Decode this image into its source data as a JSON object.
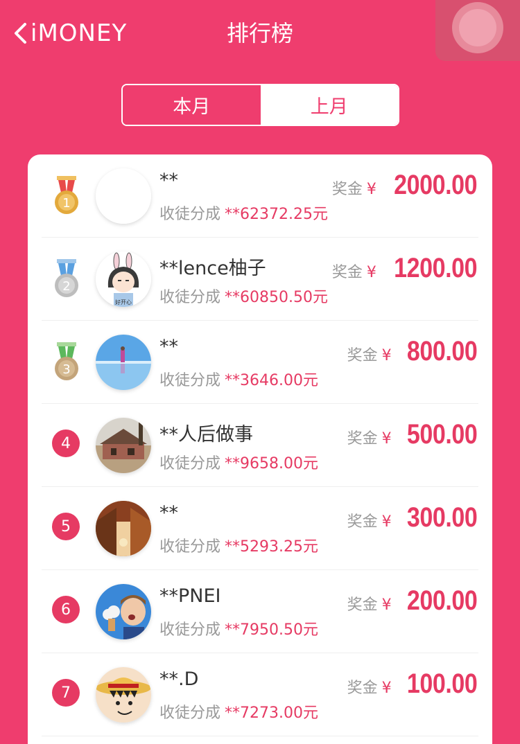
{
  "header": {
    "back_label": "iMONEY",
    "title": "排行榜"
  },
  "tabs": [
    {
      "label": "本月",
      "active": true
    },
    {
      "label": "上月",
      "active": false
    }
  ],
  "list": {
    "commission_label": "收徒分成",
    "bonus_label": "奖金",
    "currency": "¥",
    "rows": [
      {
        "rank": "1",
        "name": "**",
        "commission": "**62372.25元",
        "bonus": "2000.00",
        "medal": "gold",
        "avatar": "blank"
      },
      {
        "rank": "2",
        "name": "**lence柚子",
        "commission": "**60850.50元",
        "bonus": "1200.00",
        "medal": "silver",
        "avatar": "bunny-girl"
      },
      {
        "rank": "3",
        "name": "**",
        "commission": "**3646.00元",
        "bonus": "800.00",
        "medal": "bronze",
        "avatar": "salt-flat"
      },
      {
        "rank": "4",
        "name": "**人后做事",
        "commission": "**9658.00元",
        "bonus": "500.00",
        "medal": "none",
        "avatar": "house"
      },
      {
        "rank": "5",
        "name": "**",
        "commission": "**5293.25元",
        "bonus": "300.00",
        "medal": "none",
        "avatar": "town"
      },
      {
        "rank": "6",
        "name": "**PNEI",
        "commission": "**7950.50元",
        "bonus": "200.00",
        "medal": "none",
        "avatar": "boy-icecream"
      },
      {
        "rank": "7",
        "name": "**.D",
        "commission": "**7273.00元",
        "bonus": "100.00",
        "medal": "none",
        "avatar": "straw-hat"
      }
    ]
  },
  "colors": {
    "brand": "#ef3d6e",
    "accent": "#e63a63",
    "gold": "#e3a93c",
    "silver": "#c9c9c9",
    "bronze": "#c8a980"
  }
}
